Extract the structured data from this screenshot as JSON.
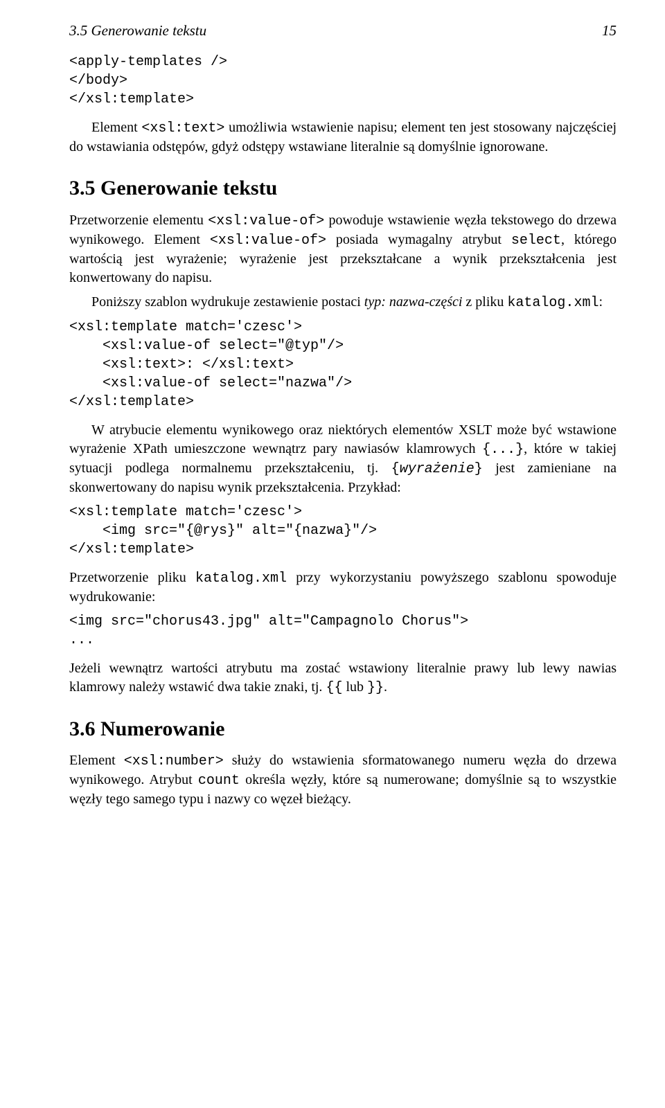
{
  "header": {
    "left": "3.5 Generowanie tekstu",
    "right": "15"
  },
  "code1": "<apply-templates />\n</body>\n</xsl:template>",
  "p1a": "Element ",
  "p1b": "<xsl:text>",
  "p1c": " umożliwia wstawienie napisu; element ten jest stosowany najczęściej do wstawiania odstępów, gdyż odstępy wstawiane literalnie są domyślnie ignorowane.",
  "sec35": "3.5   Generowanie tekstu",
  "p2a": "Przetworzenie elementu ",
  "p2b": "<xsl:value-of>",
  "p2c": " powoduje wstawienie węzła tekstowego do drzewa wynikowego. Element ",
  "p2d": "<xsl:value-of>",
  "p2e": " posiada wymagalny atrybut ",
  "p2f": "select",
  "p2g": ", którego wartością jest wyrażenie; wyrażenie jest przekształcane a wynik przekształcenia jest konwertowany do napisu.",
  "p3a": "Poniższy szablon wydrukuje zestawienie postaci ",
  "p3b": "typ: nazwa-części",
  "p3c": " z pliku ",
  "p3d": "katalog.xml",
  "p3e": ":",
  "code2": "<xsl:template match='czesc'>\n    <xsl:value-of select=\"@typ\"/>\n    <xsl:text>: </xsl:text>\n    <xsl:value-of select=\"nazwa\"/>\n</xsl:template>",
  "p4a": "W atrybucie elementu wynikowego oraz niektórych elementów XSLT może być wstawione wyrażenie XPath umieszczone wewnątrz pary nawiasów klamrowych ",
  "p4b": "{...}",
  "p4c": ", które w takiej sytuacji podlega normalnemu przekształceniu, tj. ",
  "p4d": "{",
  "p4e": "wyrażenie",
  "p4f": "}",
  "p4g": " jest zamieniane na skonwertowany do napisu wynik przekształcenia. Przykład:",
  "code3": "<xsl:template match='czesc'>\n    <img src=\"{@rys}\" alt=\"{nazwa}\"/>\n</xsl:template>",
  "p5a": "Przetworzenie pliku ",
  "p5b": "katalog.xml",
  "p5c": " przy wykorzystaniu powyższego szablonu spowoduje wydrukowanie:",
  "code4": "<img src=\"chorus43.jpg\" alt=\"Campagnolo Chorus\">\n...",
  "p6a": "Jeżeli wewnątrz wartości atrybutu ma zostać wstawiony literalnie prawy lub lewy nawias klamrowy należy wstawić dwa takie znaki, tj. ",
  "p6b": "{{",
  "p6c": " lub ",
  "p6d": "}}",
  "p6e": ".",
  "sec36": "3.6   Numerowanie",
  "p7a": "Element ",
  "p7b": "<xsl:number>",
  "p7c": " służy do wstawienia sformatowanego numeru węzła do drzewa wynikowego. Atrybut ",
  "p7d": "count",
  "p7e": " określa węzły, które są numerowane; domyślnie są to wszystkie węzły tego samego typu i nazwy co węzeł bieżący."
}
